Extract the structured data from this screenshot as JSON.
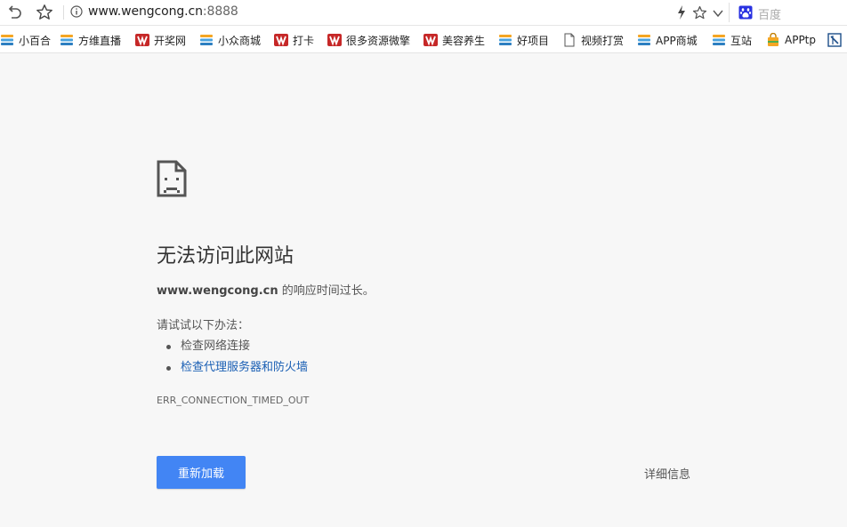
{
  "toolbar": {
    "back_icon": "undo-arrow-icon",
    "favorite_icon": "star-outline-icon",
    "info_icon": "info-circle-icon",
    "url_host": "www.wengcong.cn",
    "url_port": ":8888",
    "lightning_icon": "lightning-icon",
    "bookmark_star_icon": "star-outline-icon",
    "dropdown_icon": "chevron-down-icon",
    "search_engine_icon": "baidu-paw-icon",
    "search_placeholder": "百度"
  },
  "bookmarks": [
    {
      "label": "小百合",
      "icon": "stack-folder-icon"
    },
    {
      "label": "方维直播",
      "icon": "stack-folder-icon"
    },
    {
      "label": "开奖网",
      "icon": "red-logo-icon"
    },
    {
      "label": "小众商城",
      "icon": "stack-folder-icon"
    },
    {
      "label": "打卡",
      "icon": "red-logo-icon"
    },
    {
      "label": "很多资源微擎",
      "icon": "red-logo-icon"
    },
    {
      "label": "美容养生",
      "icon": "red-logo-icon"
    },
    {
      "label": "好项目",
      "icon": "stack-folder-icon"
    },
    {
      "label": "视频打赏",
      "icon": "page-icon"
    },
    {
      "label": "APP商城",
      "icon": "stack-folder-icon"
    },
    {
      "label": "互站",
      "icon": "stack-folder-icon"
    },
    {
      "label": "APPtp",
      "icon": "shopping-bag-icon"
    }
  ],
  "error_page": {
    "icon": "sad-document-icon",
    "title": "无法访问此网站",
    "host": "www.wengcong.cn",
    "desc_suffix": " 的响应时间过长。",
    "try_label": "请试试以下办法：",
    "suggestions": [
      "检查网络连接",
      "检查代理服务器和防火墙"
    ],
    "error_code": "ERR_CONNECTION_TIMED_OUT",
    "reload_label": "重新加载",
    "details_label": "详细信息"
  },
  "colors": {
    "accent": "#4285f4",
    "link": "#1a5fb4",
    "page_bg": "#f7f7f7"
  }
}
